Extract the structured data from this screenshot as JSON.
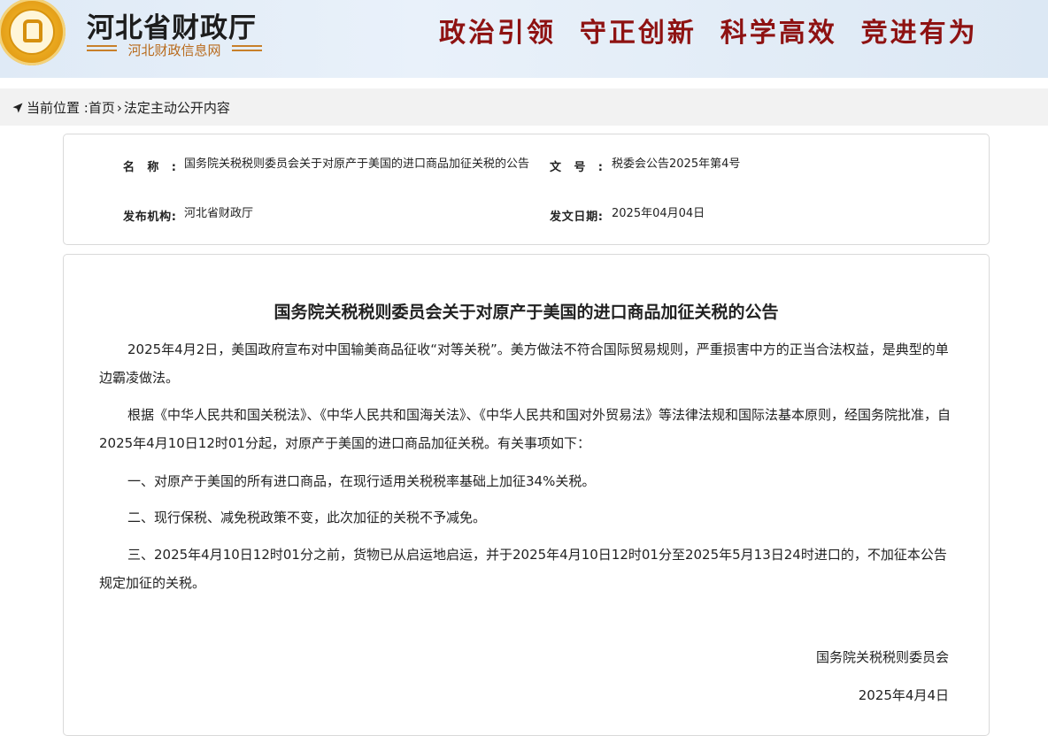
{
  "header": {
    "logo_name": "finance-department-emblem",
    "site_name": "河北省财政厅",
    "site_subtitle": "河北财政信息网",
    "slogan": "政治引领  守正创新  科学高效  竞进有为",
    "colors": {
      "slogan": "#8e1212",
      "subtitle": "#b86a1c",
      "background": "#e4eef8"
    }
  },
  "breadcrumb": {
    "icon": "location-arrow-icon",
    "prefix": "当前位置 :",
    "home": "首页",
    "separator": "›",
    "current": "法定主动公开内容"
  },
  "meta": {
    "name_label": "名称:",
    "name_value": "国务院关税税则委员会关于对原产于美国的进口商品加征关税的公告",
    "doc_no_label": "文号:",
    "doc_no_value": "税委会公告2025年第4号",
    "issuer_label": "发布机构:",
    "issuer_value": "河北省财政厅",
    "date_label": "发文日期:",
    "date_value": "2025年04月04日"
  },
  "article": {
    "title": "国务院关税税则委员会关于对原产于美国的进口商品加征关税的公告",
    "paragraphs": [
      "2025年4月2日，美国政府宣布对中国输美商品征收“对等关税”。美方做法不符合国际贸易规则，严重损害中方的正当合法权益，是典型的单边霸凌做法。",
      "根据《中华人民共和国关税法》、《中华人民共和国海关法》、《中华人民共和国对外贸易法》等法律法规和国际法基本原则，经国务院批准，自2025年4月10日12时01分起，对原产于美国的进口商品加征关税。有关事项如下：",
      "一、对原产于美国的所有进口商品，在现行适用关税税率基础上加征34%关税。",
      "二、现行保税、减免税政策不变，此次加征的关税不予减免。",
      "三、2025年4月10日12时01分之前，货物已从启运地启运，并于2025年4月10日12时01分至2025年5月13日24时进口的，不加征本公告规定加征的关税。"
    ],
    "signature": "国务院关税税则委员会",
    "sign_date": "2025年4月4日"
  }
}
